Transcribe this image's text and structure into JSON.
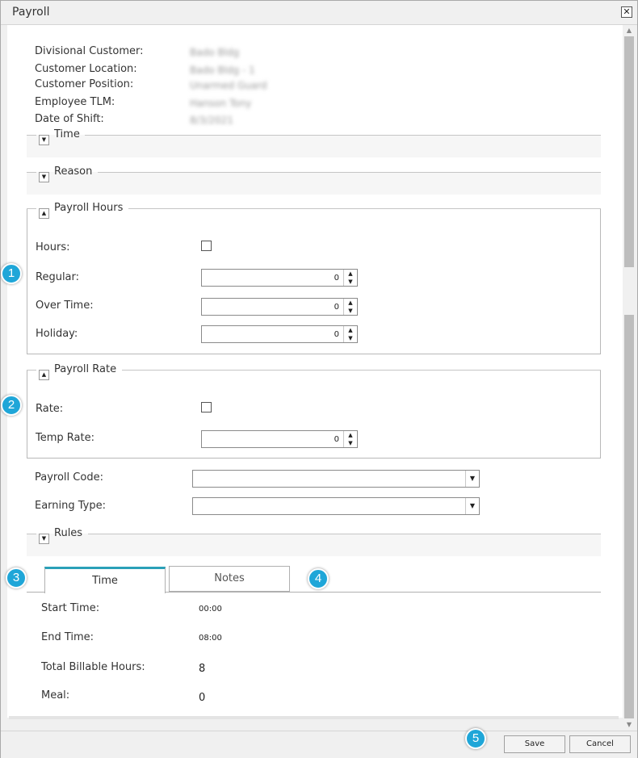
{
  "window": {
    "title": "Payroll",
    "close_glyph": "✕"
  },
  "info": [
    {
      "label": "Divisional Customer:",
      "value": "Bado Bldg"
    },
    {
      "label": "Customer Location:",
      "value": "Bado Bldg - 1"
    },
    {
      "label": "Customer Position:",
      "value": "Unarmed Guard"
    },
    {
      "label": "Employee TLM:",
      "value": "Hanson Tony"
    },
    {
      "label": "Date of Shift:",
      "value": "8/3/2021"
    }
  ],
  "sections": {
    "time": {
      "title": "Time"
    },
    "reason": {
      "title": "Reason"
    },
    "payroll_hours": {
      "title": "Payroll Hours",
      "hours_label": "Hours:",
      "regular_label": "Regular:",
      "regular_value": "0",
      "overtime_label": "Over Time:",
      "overtime_value": "0",
      "holiday_label": "Holiday:",
      "holiday_value": "0"
    },
    "payroll_rate": {
      "title": "Payroll Rate",
      "rate_label": "Rate:",
      "temp_rate_label": "Temp Rate:",
      "temp_rate_value": "0"
    },
    "rules": {
      "title": "Rules"
    }
  },
  "payroll_code_label": "Payroll Code:",
  "earning_type_label": "Earning Type:",
  "tabs": [
    {
      "label": "Time"
    },
    {
      "label": "Notes"
    }
  ],
  "details": {
    "start_time_label": "Start Time:",
    "start_time_value": "00:00",
    "end_time_label": "End Time:",
    "end_time_value": "08:00",
    "total_billable_label": "Total Billable Hours:",
    "total_billable_value": "8",
    "meal_label": "Meal:",
    "meal_value": "0"
  },
  "footer": {
    "save_label": "Save",
    "cancel_label": "Cancel"
  },
  "callouts": [
    "1",
    "2",
    "3",
    "4",
    "5"
  ],
  "icons": {
    "collapse_down": "▼",
    "collapse_up": "▲",
    "spin_up": "▲",
    "spin_down": "▼",
    "dropdown": "▼",
    "scroll_up": "▲",
    "scroll_down": "▼"
  },
  "colors": {
    "accent": "#2aa0b8",
    "callout": "#1fa6d8"
  }
}
